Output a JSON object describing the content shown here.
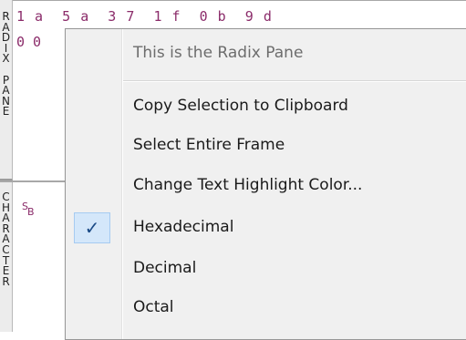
{
  "left_labels": {
    "radix": [
      "R",
      "A",
      "D",
      "I",
      "X",
      "",
      "P",
      "A",
      "N",
      "E"
    ],
    "character": [
      "C",
      "H",
      "A",
      "R",
      "A",
      "C",
      "T",
      "E",
      "R"
    ]
  },
  "radix_pane": {
    "row1": "1 a  5 a  3 7  1 f  0 b  9 d",
    "row2": "0 0",
    "sb_s": "S",
    "sb_b": "B"
  },
  "context_menu": {
    "header": "This is the Radix Pane",
    "items": [
      {
        "label": "Copy Selection to Clipboard",
        "checked": false
      },
      {
        "label": "Select Entire Frame",
        "checked": false
      },
      {
        "label": "Change Text Highlight Color...",
        "checked": false
      },
      {
        "label": "Hexadecimal",
        "checked": true
      },
      {
        "label": "Decimal",
        "checked": false
      },
      {
        "label": "Octal",
        "checked": false
      }
    ],
    "check_glyph": "✓"
  }
}
